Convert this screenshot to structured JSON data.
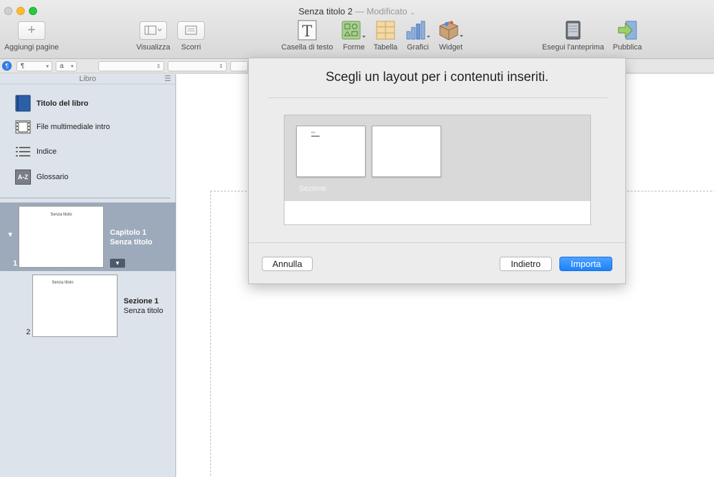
{
  "window": {
    "title": "Senza titolo 2",
    "separator": "—",
    "status": "Modificato",
    "status_chevron": "⌄"
  },
  "toolbar": {
    "add_pages": "Aggiungi pagine",
    "view": "Visualizza",
    "scroll": "Scorri",
    "text_box": "Casella di testo",
    "shapes": "Forme",
    "table": "Tabella",
    "charts": "Grafici",
    "widget": "Widget",
    "preview": "Esegui l'anteprima",
    "publish": "Pubblica"
  },
  "formatbar": {
    "paragraph_style": "¶",
    "char_style": "a"
  },
  "sidebar": {
    "header": "Libro",
    "items": [
      {
        "label": "Titolo del libro",
        "icon": "book-icon"
      },
      {
        "label": "File multimediale intro",
        "icon": "film-icon"
      },
      {
        "label": "Indice",
        "icon": "list-icon"
      },
      {
        "label": "Glossario",
        "icon": "glossary-icon",
        "icon_text": "A-Z"
      }
    ],
    "chapter": {
      "page_number": "1",
      "thumb_title": "Senza titolo",
      "line1": "Capitolo 1",
      "line2": "Senza titolo"
    },
    "section": {
      "page_number": "2",
      "thumb_title": "Senza titolo",
      "line1": "Sezione 1",
      "line2": "Senza titolo"
    }
  },
  "dialog": {
    "title": "Scegli un layout per i contenuti inseriti.",
    "group_label": "Sezione",
    "cancel": "Annulla",
    "back": "Indietro",
    "import": "Importa"
  },
  "colors": {
    "accent": "#1a82fb",
    "sidebar_selection": "#9daabb",
    "sidebar_bg": "#dde3ea"
  }
}
